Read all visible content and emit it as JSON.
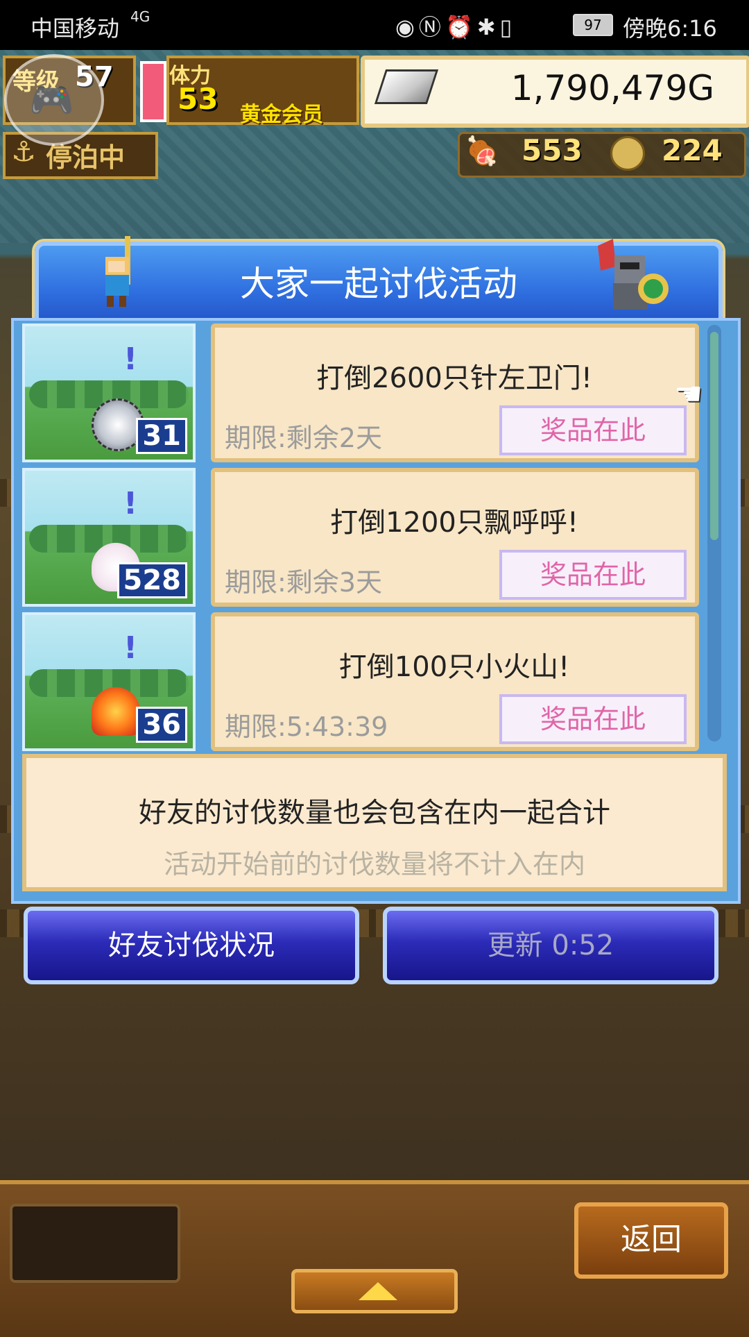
{
  "status_bar": {
    "carrier": "中国移动",
    "network": "4G",
    "battery": "97",
    "time": "傍晚6:16"
  },
  "hud": {
    "level_label": "等级",
    "level_value": "57",
    "stamina_label": "体力",
    "stamina_value": "53",
    "membership": "黄金会员",
    "money": "1,790,479G",
    "docking_status": "停泊中",
    "meat": "553",
    "coins": "224"
  },
  "dialog": {
    "title": "大家一起讨伐活动",
    "missions": [
      {
        "title": "打倒2600只针左卫门!",
        "limit": "期限:剩余2天",
        "prize_label": "奖品在此",
        "count": "31"
      },
      {
        "title": "打倒1200只飘呼呼!",
        "limit": "期限:剩余3天",
        "prize_label": "奖品在此",
        "count": "528"
      },
      {
        "title": "打倒100只小火山!",
        "limit": "期限:5:43:39",
        "prize_label": "奖品在此",
        "count": "36"
      }
    ],
    "info_main": "好友的讨伐数量也会包含在内一起合计",
    "info_sub": "活动开始前的讨伐数量将不计入在内",
    "friends_button": "好友讨伐状况",
    "refresh_button": "更新 0:52"
  },
  "bottom": {
    "back_button": "返回"
  },
  "colors": {
    "title_blue": "#2f6fe0",
    "prize_text": "#e065a8",
    "panel_blue": "#5aa2de",
    "card_bg": "#f8e6c6"
  },
  "icons": [
    "eye-icon",
    "nfc-icon",
    "alarm-icon",
    "bluetooth-icon",
    "vibrate-icon",
    "battery-icon",
    "anchor-icon",
    "meat-icon",
    "coin-icon",
    "ingot-icon",
    "pointing-hand-icon",
    "up-arrow-icon",
    "gamepad-icon"
  ]
}
